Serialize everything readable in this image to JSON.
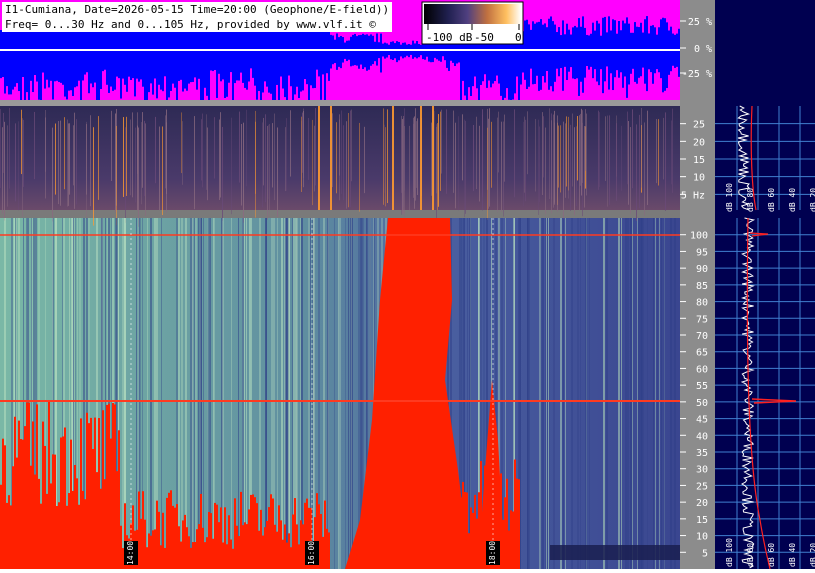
{
  "header": {
    "line1": "I1-Cumiana, Date=2026-05-15 Time=20:00 (Geophone/E-field))",
    "line2": "Freq= 0...30 Hz and 0...105 Hz, provided by www.vlf.it ©"
  },
  "colorbar": {
    "ticks": [
      "-100 dB",
      "-50",
      "0"
    ]
  },
  "chart_data": [
    {
      "type": "area",
      "name": "waveform",
      "y_ticks": [
        "25 %",
        "0 %",
        "-25 %"
      ],
      "ylim": [
        -40,
        40
      ],
      "colors": {
        "background": "#ff00ff",
        "signal": "#0000ff",
        "trace": "#ffffff"
      }
    },
    {
      "type": "heatmap",
      "name": "spectrogram-0-30hz",
      "y_ticks": [
        "25",
        "20",
        "15",
        "10",
        "5 Hz"
      ],
      "y_tick_values": [
        25,
        20,
        15,
        10,
        5
      ],
      "ylim": [
        0,
        30
      ],
      "colors": {
        "low": "#3a3660",
        "mid": "#6a4a78",
        "high": "#ff9a30"
      }
    },
    {
      "type": "heatmap",
      "name": "spectrogram-0-105hz",
      "y_ticks": [
        "100",
        "95",
        "90",
        "85",
        "80",
        "75",
        "70",
        "65",
        "60",
        "55",
        "50",
        "45",
        "40",
        "35",
        "30",
        "25",
        "20",
        "15",
        "10",
        "5"
      ],
      "y_tick_values": [
        100,
        95,
        90,
        85,
        80,
        75,
        70,
        65,
        60,
        55,
        50,
        45,
        40,
        35,
        30,
        25,
        20,
        15,
        10,
        5
      ],
      "ylim": [
        0,
        105
      ],
      "x_ticks": [
        "14:00",
        "16:00",
        "18:00"
      ],
      "colors": {
        "background": "#3c4a90",
        "noise": "#6fa8a0",
        "saturated": "#ff2000",
        "line": "#ff3a20"
      }
    },
    {
      "type": "line",
      "name": "spectrum-profile",
      "x_ticks": [
        "dB 100",
        "dB 80",
        "dB 60",
        "dB 40",
        "dB 20"
      ],
      "top_ticks": [
        "dB 100",
        "dB 80",
        "dB 60",
        "dB 40",
        "dB 20"
      ],
      "colors": {
        "background": "#000050",
        "grid": "#4080d0",
        "trace": "#ffffff",
        "fit": "#ff2020"
      }
    }
  ]
}
